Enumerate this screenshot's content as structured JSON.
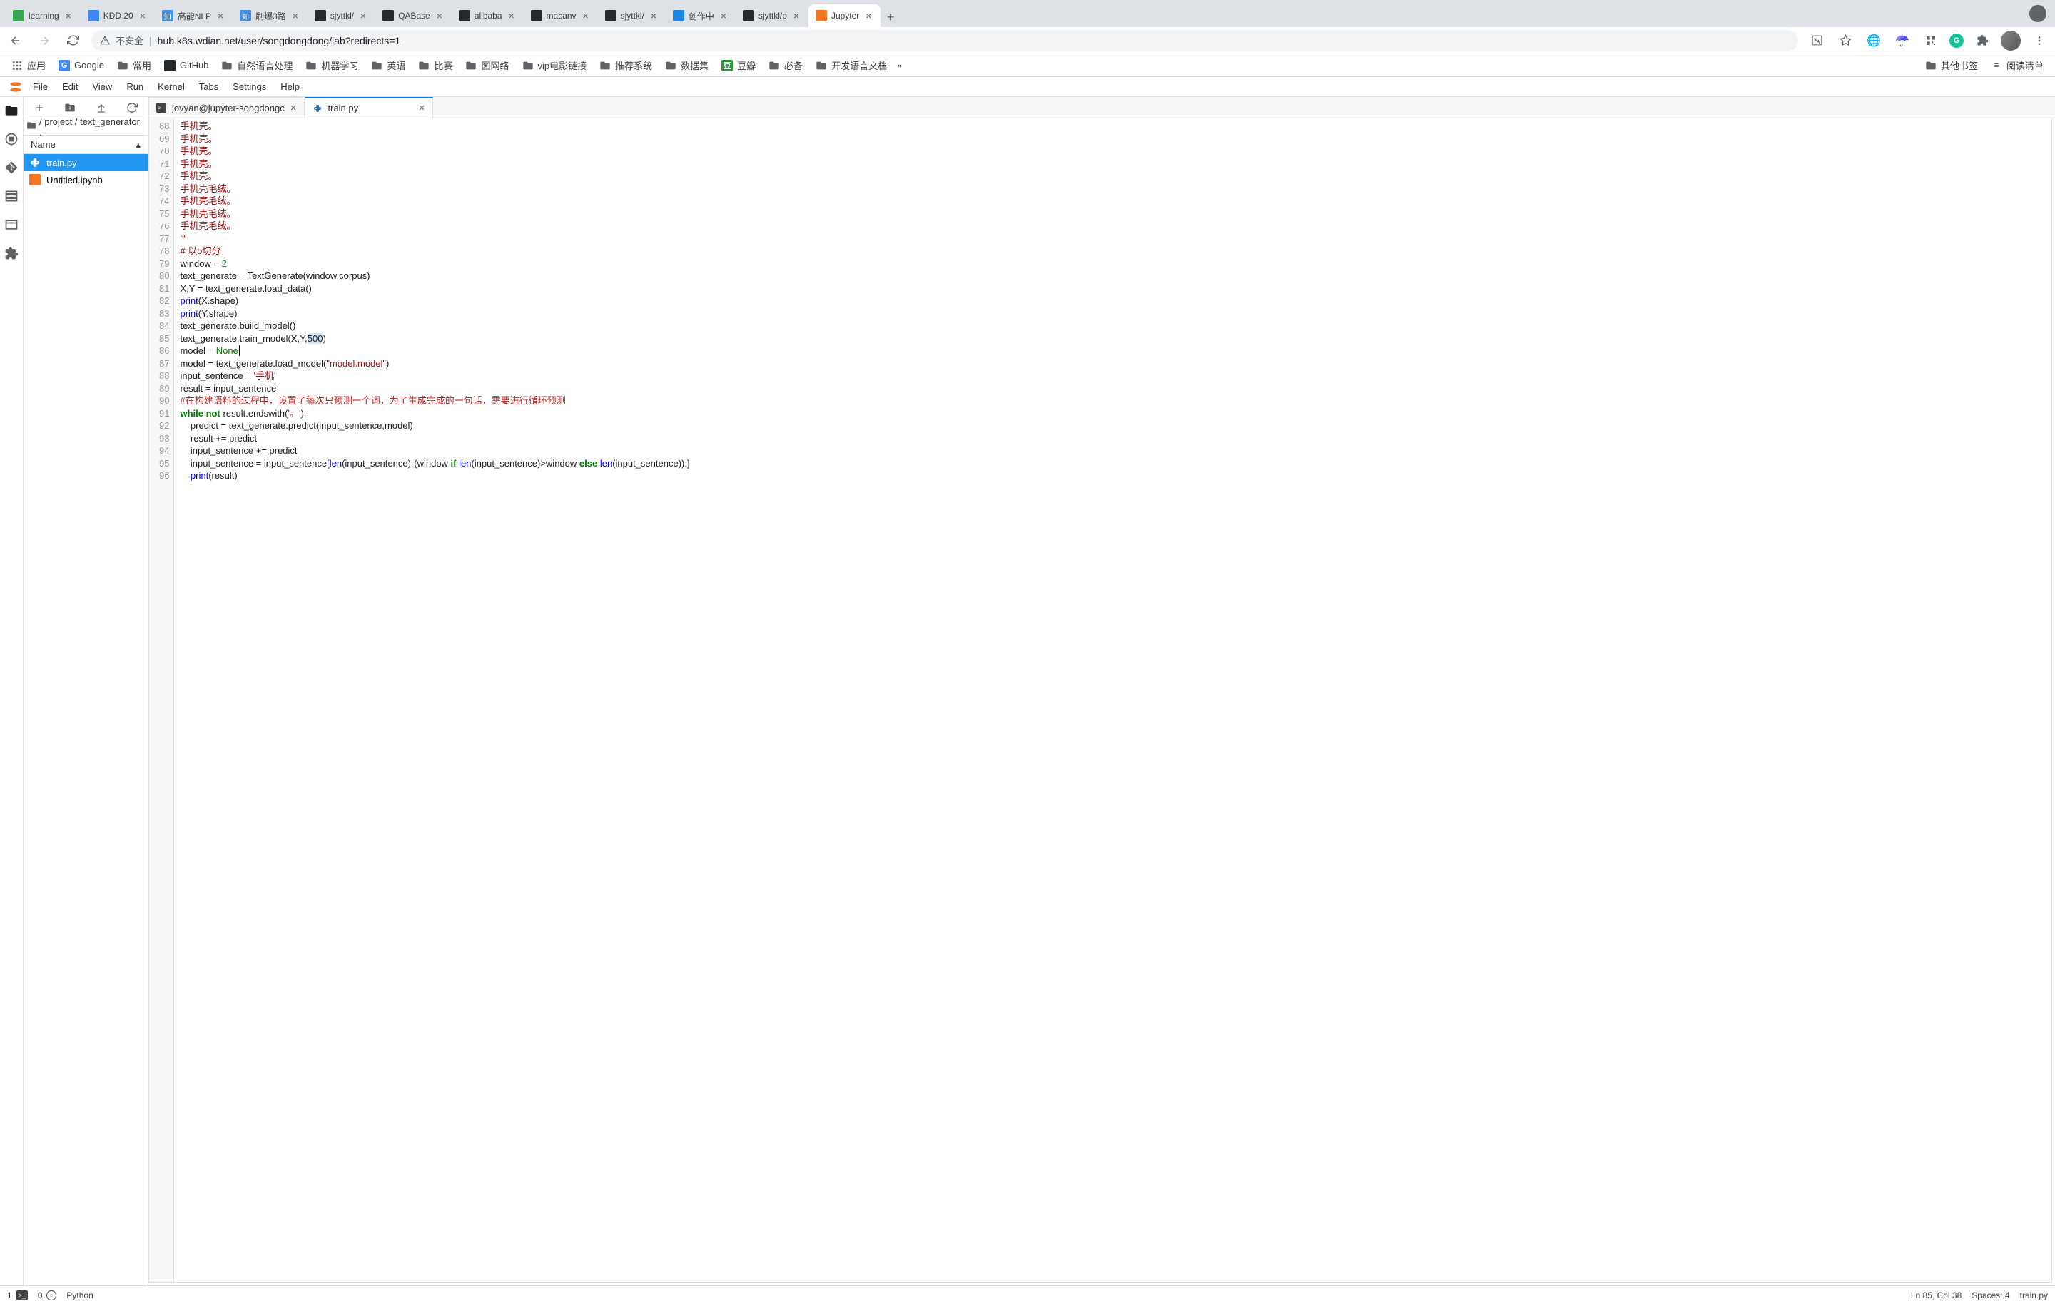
{
  "browser": {
    "tabs": [
      {
        "title": "learning",
        "favicon_bg": "#34a853",
        "favicon_text": ""
      },
      {
        "title": "KDD 20",
        "favicon_bg": "#4285f4",
        "favicon_text": ""
      },
      {
        "title": "高能NLP",
        "favicon_bg": "#4a90e2",
        "favicon_text": "知"
      },
      {
        "title": "刷爆3路",
        "favicon_bg": "#4a90e2",
        "favicon_text": "知"
      },
      {
        "title": "sjyttkl/",
        "favicon_bg": "#24292e",
        "favicon_text": ""
      },
      {
        "title": "QABase",
        "favicon_bg": "#24292e",
        "favicon_text": ""
      },
      {
        "title": "alibaba",
        "favicon_bg": "#24292e",
        "favicon_text": ""
      },
      {
        "title": "macanv",
        "favicon_bg": "#24292e",
        "favicon_text": ""
      },
      {
        "title": "sjyttkl/",
        "favicon_bg": "#24292e",
        "favicon_text": ""
      },
      {
        "title": "创作中",
        "favicon_bg": "#1e88e5",
        "favicon_text": ""
      },
      {
        "title": "sjyttkl/p",
        "favicon_bg": "#24292e",
        "favicon_text": ""
      },
      {
        "title": "Jupyter",
        "favicon_bg": "#f37626",
        "favicon_text": "",
        "active": true
      }
    ],
    "security_label": "不安全",
    "url": "hub.k8s.wdian.net/user/songdongdong/lab?redirects=1"
  },
  "bookmarks": {
    "apps": "应用",
    "items": [
      {
        "label": "Google",
        "icon": "G",
        "icon_color": "#4285f4"
      },
      {
        "label": "常用",
        "folder": true
      },
      {
        "label": "GitHub",
        "icon": "",
        "icon_color": "#24292e"
      },
      {
        "label": "自然语言处理",
        "folder": true
      },
      {
        "label": "机器学习",
        "folder": true
      },
      {
        "label": "英语",
        "folder": true
      },
      {
        "label": "比赛",
        "folder": true
      },
      {
        "label": "图网络",
        "folder": true
      },
      {
        "label": "vip电影链接",
        "folder": true
      },
      {
        "label": "推荐系统",
        "folder": true
      },
      {
        "label": "数据集",
        "folder": true
      },
      {
        "label": "豆瓣",
        "icon": "豆",
        "icon_color": "#2e963d"
      },
      {
        "label": "必备",
        "folder": true
      },
      {
        "label": "开发语言文档",
        "folder": true
      }
    ],
    "right": [
      {
        "label": "其他书签",
        "folder": true
      },
      {
        "label": "阅读清单",
        "icon": "≡"
      }
    ]
  },
  "jupyter": {
    "menus": [
      "File",
      "Edit",
      "View",
      "Run",
      "Kernel",
      "Tabs",
      "Settings",
      "Help"
    ],
    "breadcrumb": "/ project / text_generator .",
    "file_header": "Name",
    "files": [
      {
        "name": "train.py",
        "type": "py",
        "selected": true
      },
      {
        "name": "Untitled.ipynb",
        "type": "nb",
        "selected": false
      }
    ],
    "editor_tabs": [
      {
        "label": "jovyan@jupyter-songdongc",
        "icon": "terminal",
        "active": false
      },
      {
        "label": "train.py",
        "icon": "py",
        "active": true
      }
    ]
  },
  "code": {
    "first_line": 68,
    "lines": [
      [
        [
          "str",
          "手机壳。"
        ]
      ],
      [
        [
          "str",
          "手机壳。"
        ]
      ],
      [
        [
          "str",
          "手机壳。"
        ]
      ],
      [
        [
          "str",
          "手机壳。"
        ]
      ],
      [
        [
          "str",
          "手机壳。"
        ]
      ],
      [
        [
          "str",
          "手机壳毛绒。"
        ]
      ],
      [
        [
          "str",
          "手机壳毛绒。"
        ]
      ],
      [
        [
          "str",
          "手机壳毛绒。"
        ]
      ],
      [
        [
          "str",
          "手机壳毛绒。"
        ]
      ],
      [
        [
          "str",
          "'''"
        ]
      ],
      [
        [
          "comment",
          "# 以5切分"
        ]
      ],
      [
        [
          "plain",
          "window = "
        ],
        [
          "num",
          "2"
        ]
      ],
      [
        [
          "plain",
          "text_generate = TextGenerate(window,corpus)"
        ]
      ],
      [
        [
          "plain",
          "X,Y = text_generate.load_data()"
        ]
      ],
      [
        [
          "builtin",
          "print"
        ],
        [
          "plain",
          "(X.shape)"
        ]
      ],
      [
        [
          "builtin",
          "print"
        ],
        [
          "plain",
          "(Y.shape)"
        ]
      ],
      [
        [
          "plain",
          "text_generate.build_model()"
        ]
      ],
      [
        [
          "plain",
          "text_generate.train_model(X,Y,"
        ],
        [
          "sel",
          "500"
        ],
        [
          "plain",
          ")"
        ]
      ],
      [
        [
          "plain",
          "model = "
        ],
        [
          "none",
          "None"
        ],
        [
          "caret",
          ""
        ]
      ],
      [
        [
          "plain",
          "model = text_generate.load_model("
        ],
        [
          "str",
          "\"model.model\""
        ],
        [
          "plain",
          ")"
        ]
      ],
      [
        [
          "plain",
          "input_sentence = "
        ],
        [
          "str",
          "'手机'"
        ]
      ],
      [
        [
          "plain",
          "result = input_sentence"
        ]
      ],
      [
        [
          "comment2",
          "#在构建语料的过程中，设置了每次只预测一个词，为了生成完成的一句话，需要进行循环预测"
        ]
      ],
      [
        [
          "kw",
          "while"
        ],
        [
          "plain",
          " "
        ],
        [
          "kw",
          "not"
        ],
        [
          "plain",
          " result.endswith("
        ],
        [
          "str",
          "'。'"
        ],
        [
          "plain",
          "):"
        ]
      ],
      [
        [
          "plain",
          "    predict = text_generate.predict(input_sentence,model)"
        ]
      ],
      [
        [
          "plain",
          "    result += predict"
        ]
      ],
      [
        [
          "plain",
          "    input_sentence += predict"
        ]
      ],
      [
        [
          "plain",
          "    input_sentence = input_sentence["
        ],
        [
          "builtin",
          "len"
        ],
        [
          "plain",
          "(input_sentence)-(window "
        ],
        [
          "kw",
          "if"
        ],
        [
          "plain",
          " "
        ],
        [
          "builtin",
          "len"
        ],
        [
          "plain",
          "(input_sentence)>window "
        ],
        [
          "kw",
          "else"
        ],
        [
          "plain",
          " "
        ],
        [
          "builtin",
          "len"
        ],
        [
          "plain",
          "(input_sentence)):]"
        ]
      ],
      [
        [
          "plain",
          "    "
        ],
        [
          "builtin",
          "print"
        ],
        [
          "plain",
          "(result)"
        ]
      ]
    ]
  },
  "status": {
    "terminals": "1",
    "kernels": "0",
    "language": "Python",
    "cursor": "Ln 85, Col 38",
    "spaces": "Spaces: 4",
    "filename": "train.py"
  }
}
